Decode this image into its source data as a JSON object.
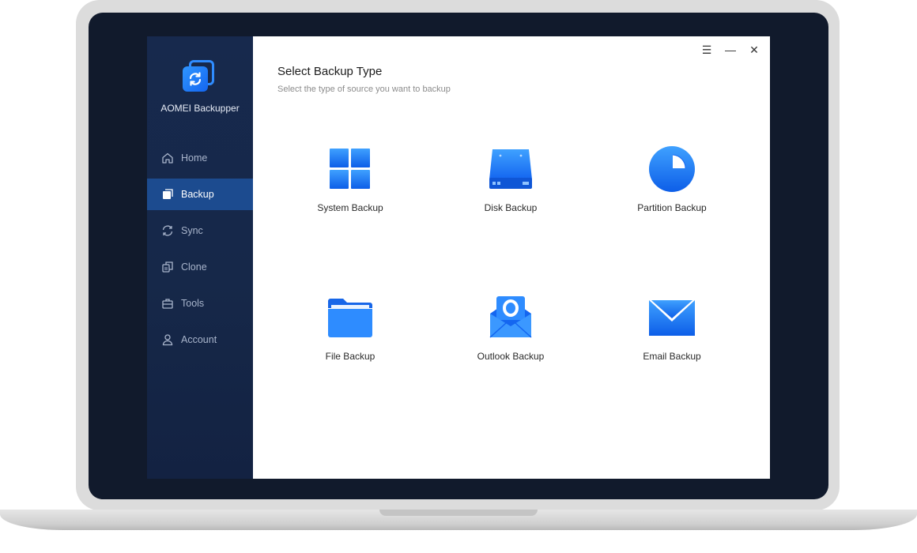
{
  "app": {
    "name": "AOMEI Backupper"
  },
  "sidebar": {
    "items": [
      {
        "label": "Home",
        "icon": "home-icon",
        "active": false
      },
      {
        "label": "Backup",
        "icon": "backup-icon",
        "active": true
      },
      {
        "label": "Sync",
        "icon": "sync-icon",
        "active": false
      },
      {
        "label": "Clone",
        "icon": "clone-icon",
        "active": false
      },
      {
        "label": "Tools",
        "icon": "tools-icon",
        "active": false
      },
      {
        "label": "Account",
        "icon": "account-icon",
        "active": false
      }
    ]
  },
  "window_controls": {
    "menu": "☰",
    "minimize": "—",
    "close": "✕"
  },
  "main": {
    "title": "Select Backup Type",
    "subtitle": "Select the type of source you want to backup",
    "options": [
      {
        "label": "System Backup",
        "icon": "windows-icon"
      },
      {
        "label": "Disk Backup",
        "icon": "disk-icon"
      },
      {
        "label": "Partition Backup",
        "icon": "partition-pie-icon"
      },
      {
        "label": "File Backup",
        "icon": "folder-icon"
      },
      {
        "label": "Outlook Backup",
        "icon": "outlook-icon"
      },
      {
        "label": "Email Backup",
        "icon": "envelope-icon"
      }
    ]
  },
  "colors": {
    "accent": "#1e6ff0",
    "sidebar_bg": "#162849",
    "active_nav": "#1c4b8f",
    "bezel": "#111a2c"
  }
}
